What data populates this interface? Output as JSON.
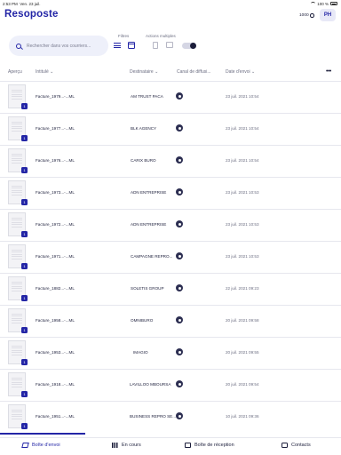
{
  "status_bar": {
    "time": "2:53 PM",
    "date": "Ven. 23 juil.",
    "battery": "100 %"
  },
  "header": {
    "title": "Resoposte",
    "credits": "1000",
    "avatar_initials": "PH"
  },
  "toolbar": {
    "search_placeholder": "Rechercher dans vos courriers...",
    "filters_label": "Filtres",
    "actions_label": "Actions multiples"
  },
  "table": {
    "columns": [
      "Aperçu",
      "Intitulé",
      "Destinataire",
      "Canal de diffusi...",
      "Date d'envoi"
    ],
    "rows": [
      {
        "badge": "1",
        "title": "Facture_1979...-...ML",
        "recipient": "AM TRUST PACA",
        "date": "23 juil. 2021 10:54"
      },
      {
        "badge": "1",
        "title": "Facture_1977...-...ML",
        "recipient": "BLK AGENCY",
        "date": "23 juil. 2021 10:54"
      },
      {
        "badge": "1",
        "title": "Facture_1976...-...ML",
        "recipient": "CARIX BURO",
        "date": "23 juil. 2021 10:54"
      },
      {
        "badge": "1",
        "title": "Facture_1973...-...ML",
        "recipient": "ADN ENTREPRISE",
        "date": "23 juil. 2021 10:53"
      },
      {
        "badge": "1",
        "title": "Facture_1972...-...ML",
        "recipient": "ADN ENTREPRISE",
        "date": "23 juil. 2021 10:53"
      },
      {
        "badge": "1",
        "title": "Facture_1971...-...ML",
        "recipient": "CAMPAGNE REPRO...",
        "date": "23 juil. 2021 10:53"
      },
      {
        "badge": "1",
        "title": "Facture_1882...-...ML",
        "recipient": "SOLETIS GROUP",
        "date": "22 juil. 2021 09:23"
      },
      {
        "badge": "1",
        "title": "Facture_1958...-...ML",
        "recipient": "OMNIBURO",
        "date": "20 juil. 2021 09:58"
      },
      {
        "badge": "1",
        "title": "Facture_1953...-...ML",
        "recipient": "IMAGIO",
        "date": "20 juil. 2021 09:55"
      },
      {
        "badge": "1",
        "title": "Facture_1918...-...ML",
        "recipient": "LAVILLOO MBOURSA",
        "date": "20 juil. 2021 09:54"
      },
      {
        "badge": "1",
        "title": "Facture_1951...-...ML",
        "recipient": "BUSINESS REPRO SE...",
        "date": "10 juil. 2021 09:36"
      }
    ]
  },
  "tabs": [
    {
      "label": "Boîte d'envoi",
      "icon": "send-icon"
    },
    {
      "label": "En cours",
      "icon": "grid-icon"
    },
    {
      "label": "Boîte de réception",
      "icon": "mail-icon"
    },
    {
      "label": "Contacts",
      "icon": "contacts-icon"
    }
  ],
  "colors": {
    "brand": "#2325a6",
    "text": "#1b1d3a",
    "muted": "#6c6e82",
    "search_bg": "#eef0fa"
  }
}
